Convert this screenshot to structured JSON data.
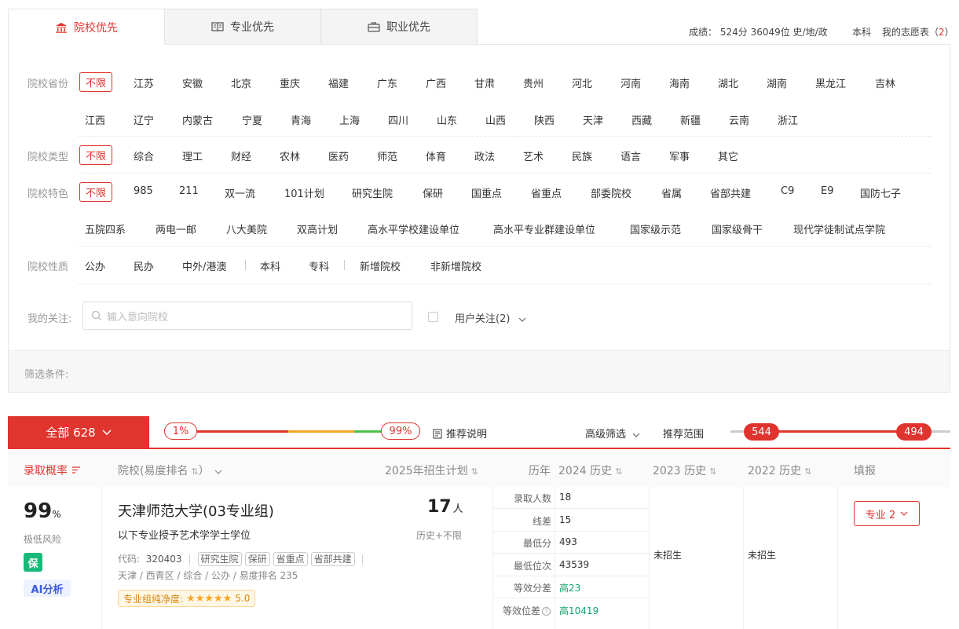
{
  "tabs": [
    {
      "label": "院校优先",
      "icon": "building-icon",
      "active": true
    },
    {
      "label": "专业优先",
      "icon": "book-icon",
      "active": false
    },
    {
      "label": "职业优先",
      "icon": "briefcase-icon",
      "active": false
    }
  ],
  "score": {
    "prefix": "成绩：",
    "value": "524分 36049位 史/地/政",
    "level": "本科",
    "wishlist_label": "我的志愿表（",
    "wishlist_count": "2",
    "wishlist_suffix": "）"
  },
  "filters": {
    "province": {
      "label": "院校省份",
      "nolimit": "不限",
      "row1": [
        "江苏",
        "安徽",
        "北京",
        "重庆",
        "福建",
        "广东",
        "广西",
        "甘肃",
        "贵州",
        "河北",
        "河南",
        "海南",
        "湖北",
        "湖南",
        "黑龙江",
        "吉林"
      ],
      "row2": [
        "江西",
        "辽宁",
        "内蒙古",
        "宁夏",
        "青海",
        "上海",
        "四川",
        "山东",
        "山西",
        "陕西",
        "天津",
        "西藏",
        "新疆",
        "云南",
        "浙江"
      ]
    },
    "type": {
      "label": "院校类型",
      "nolimit": "不限",
      "items": [
        "综合",
        "理工",
        "财经",
        "农林",
        "医药",
        "师范",
        "体育",
        "政法",
        "艺术",
        "民族",
        "语言",
        "军事",
        "其它"
      ]
    },
    "feature": {
      "label": "院校特色",
      "nolimit": "不限",
      "row1": [
        "985",
        "211",
        "双一流",
        "101计划",
        "研究生院",
        "保研",
        "国重点",
        "省重点",
        "部委院校",
        "省属",
        "省部共建",
        "C9",
        "E9",
        "国防七子"
      ],
      "row2": [
        "五院四系",
        "两电一邮",
        "八大美院",
        "双高计划",
        "高水平学校建设单位",
        "高水平专业群建设单位",
        "国家级示范",
        "国家级骨干",
        "现代学徒制试点学院"
      ]
    },
    "nature": {
      "label": "院校性质",
      "items": [
        "公办",
        "民办",
        "中外/港澳",
        "本科",
        "专科",
        "新增院校",
        "非新增院校"
      ]
    },
    "follow": {
      "label": "我的关注:",
      "placeholder": "输入意向院校",
      "user_follow": "用户关注(2)"
    },
    "conditions_label": "筛选条件:"
  },
  "results": {
    "all_label": "全部 628",
    "min_pct": "1%",
    "max_pct": "99%",
    "explain": "推荐说明",
    "advanced": "高级筛选",
    "range_label": "推荐范围",
    "range_high": "544",
    "range_low": "494"
  },
  "table": {
    "headers": {
      "prob": "录取概率",
      "school": "院校(易度排名",
      "school_suffix": "）",
      "plan": "2025年招生计划",
      "history": "历年",
      "y2024": "2024 历史",
      "y2023": "2023 历史",
      "y2022": "2022 历史",
      "fill": "填报"
    },
    "row": {
      "prob": "99",
      "prob_unit": "%",
      "risk": "极低风险",
      "badge": "保",
      "ai": "AI分析",
      "name": "天津师范大学(03专业组)",
      "note": "以下专业授予艺术学学士学位",
      "code_label": "代码:",
      "code": "320403",
      "tags": [
        "研究生院",
        "保研",
        "省重点",
        "省部共建"
      ],
      "location": "天津 / 西青区 / 综合 / 公办 / 易度排名 235",
      "purity_label": "专业组纯净度:",
      "purity": "5.0",
      "stars": 5,
      "plan_num": "17",
      "plan_unit": "人",
      "plan_note": "历史+不限",
      "hist": [
        {
          "label": "录取人数",
          "value": "18"
        },
        {
          "label": "线差",
          "value": "15"
        },
        {
          "label": "最低分",
          "value": "493"
        },
        {
          "label": "最低位次",
          "value": "43539"
        },
        {
          "label": "等效分差",
          "value": "高23"
        },
        {
          "label": "等效位差",
          "value": "高10419"
        }
      ],
      "y2023": "未招生",
      "y2022": "未招生",
      "fill_btn": "专业 2"
    }
  },
  "colors": {
    "accent": "#e0342e",
    "green": "#13a36b",
    "orange": "#f5a623"
  }
}
